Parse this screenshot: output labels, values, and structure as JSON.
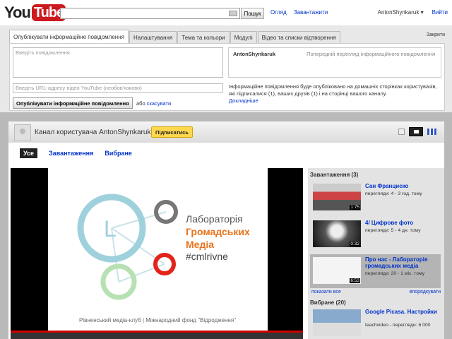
{
  "logo": {
    "you": "You",
    "tube": "Tube"
  },
  "search": {
    "button": "Пошук"
  },
  "nav": {
    "browse": "Огляд",
    "upload": "Завантажити"
  },
  "user": {
    "name": "AntonShynkaruk",
    "signout": "Вийти"
  },
  "bulletin": {
    "tabs": [
      "Опублікувати інформаційне повідомлення",
      "Налаштування",
      "Тема та кольори",
      "Модулі",
      "Відео та списки відтворення"
    ],
    "close": "Закрити",
    "message_placeholder": "Введіть повідомлення",
    "preview_user": "AntonShynkaruk",
    "preview_label": "Попередній перегляд інформаційного повідомлення",
    "url_placeholder": "Введіть URL-адресу відео YouTube (необов'язково)",
    "info_text": "Інформаційне повідомлення буде опубліковано на домашніх сторінках користувачів, які підписалися (1), ваших друзів (1) і на сторінці вашого каналу.",
    "learn_more": "Докладніше",
    "post_button": "Опублікувати інформаційне повідомлення",
    "or": "або",
    "cancel": "скасувати"
  },
  "channel": {
    "title": "Канал користувача AntonShynkaruk",
    "subscribe": "Підписатись",
    "tabs": {
      "all": "Усе",
      "uploads": "Завантаження",
      "favorites": "Вибране"
    }
  },
  "slide": {
    "line1": "Лабораторія",
    "line2": "Громадських",
    "line3": "Медіа",
    "hashtag": "#cmlrivne",
    "letter": "L",
    "footer": "Рівненський медіа-клуб | Міжнародний фонд \"Відродження\""
  },
  "sidebar": {
    "uploads_header": "Завантаження (3)",
    "favorites_header": "Вибране (20)",
    "show_all": "показати все",
    "sort": "впорядкувати",
    "videos": [
      {
        "title": "Сан Франциско",
        "meta": "перегляди: 4 - 3 год. тому",
        "duration": "1:75"
      },
      {
        "title": "4/ Цифрове фото",
        "meta": "перегляди: 5 - 4 дн. тому",
        "duration": "0:32"
      },
      {
        "title": "Про нас - Лабораторія громадських медіа",
        "meta": "перегляди: 20 - 1 міс. тому",
        "duration": "6:53"
      }
    ],
    "fav": {
      "title": "Google Picasa. Настройки",
      "meta": "teachvideo - перегляди: 6 000"
    }
  }
}
